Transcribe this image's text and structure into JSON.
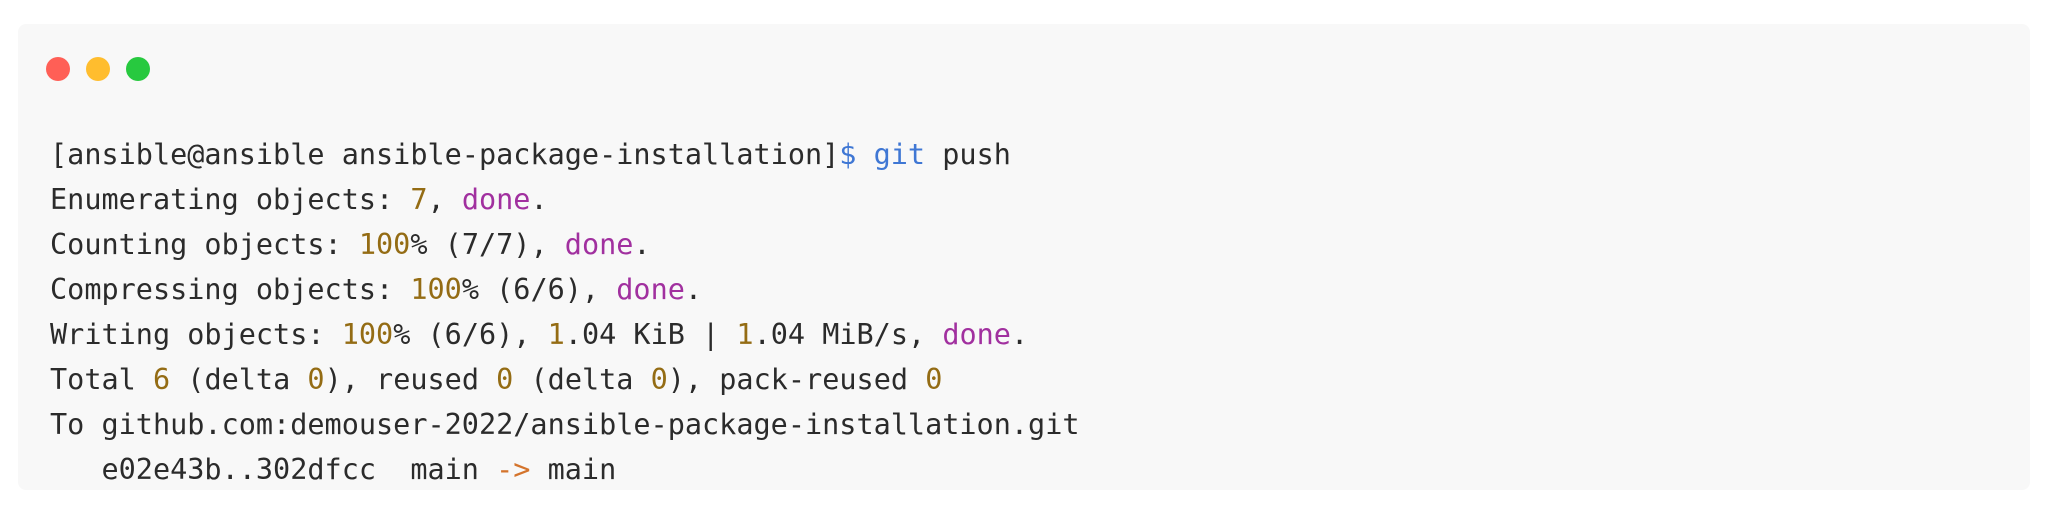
{
  "window": {
    "traffic_lights": [
      {
        "name": "close-dot",
        "color": "#ff5f56"
      },
      {
        "name": "minimize-dot",
        "color": "#ffbd2e"
      },
      {
        "name": "maximize-dot",
        "color": "#27c93f"
      }
    ]
  },
  "colors": {
    "number": "#946c14",
    "keyword": "#a1309f",
    "command": "#3f77d4",
    "arrow": "#d4742c",
    "text": "#2b2b2b",
    "background": "#f8f8f8"
  },
  "terminal": {
    "lines": [
      [
        {
          "t": "[ansible@ansible ansible-package-installation]",
          "c": ""
        },
        {
          "t": "$ git",
          "c": "cmd"
        },
        {
          "t": " push",
          "c": ""
        }
      ],
      [
        {
          "t": "Enumerating objects: ",
          "c": ""
        },
        {
          "t": "7",
          "c": "num"
        },
        {
          "t": ", ",
          "c": ""
        },
        {
          "t": "done",
          "c": "kw"
        },
        {
          "t": ".",
          "c": ""
        }
      ],
      [
        {
          "t": "Counting objects: ",
          "c": ""
        },
        {
          "t": "100",
          "c": "num"
        },
        {
          "t": "% (7/7), ",
          "c": ""
        },
        {
          "t": "done",
          "c": "kw"
        },
        {
          "t": ".",
          "c": ""
        }
      ],
      [
        {
          "t": "Compressing objects: ",
          "c": ""
        },
        {
          "t": "100",
          "c": "num"
        },
        {
          "t": "% (6/6), ",
          "c": ""
        },
        {
          "t": "done",
          "c": "kw"
        },
        {
          "t": ".",
          "c": ""
        }
      ],
      [
        {
          "t": "Writing objects: ",
          "c": ""
        },
        {
          "t": "100",
          "c": "num"
        },
        {
          "t": "% (6/6), ",
          "c": ""
        },
        {
          "t": "1",
          "c": "num"
        },
        {
          "t": ".04 KiB | ",
          "c": ""
        },
        {
          "t": "1",
          "c": "num"
        },
        {
          "t": ".04 MiB/s, ",
          "c": ""
        },
        {
          "t": "done",
          "c": "kw"
        },
        {
          "t": ".",
          "c": ""
        }
      ],
      [
        {
          "t": "Total ",
          "c": ""
        },
        {
          "t": "6",
          "c": "num"
        },
        {
          "t": " (delta ",
          "c": ""
        },
        {
          "t": "0",
          "c": "num"
        },
        {
          "t": "), reused ",
          "c": ""
        },
        {
          "t": "0",
          "c": "num"
        },
        {
          "t": " (delta ",
          "c": ""
        },
        {
          "t": "0",
          "c": "num"
        },
        {
          "t": "), pack-reused ",
          "c": ""
        },
        {
          "t": "0",
          "c": "num"
        }
      ],
      [
        {
          "t": "To github.com:demouser-2022/ansible-package-installation.git",
          "c": ""
        }
      ],
      [
        {
          "t": "   e02e43b..302dfcc  main ",
          "c": ""
        },
        {
          "t": "->",
          "c": "arrow"
        },
        {
          "t": " main",
          "c": ""
        }
      ]
    ]
  }
}
